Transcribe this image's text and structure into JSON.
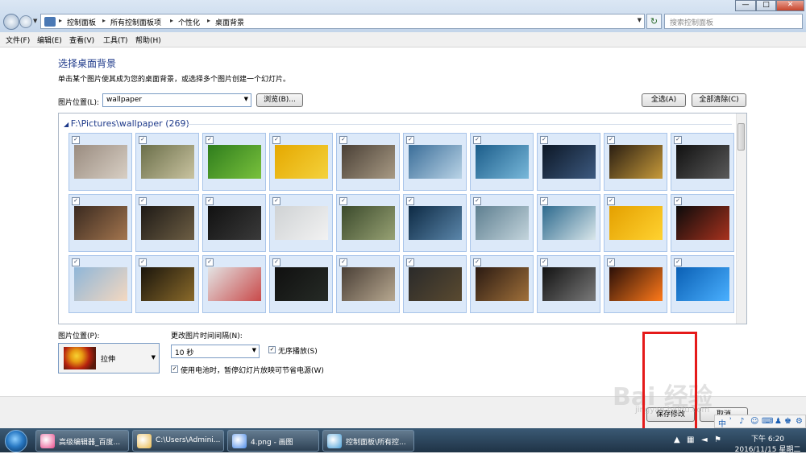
{
  "window": {
    "breadcrumbs": [
      "控制面板",
      "所有控制面板项",
      "个性化",
      "桌面背景"
    ],
    "search_placeholder": "搜索控制面板",
    "buttons": {
      "minimize": "—",
      "maximize": "□",
      "close": "✕"
    }
  },
  "menu": [
    {
      "label": "文件(F)"
    },
    {
      "label": "编辑(E)"
    },
    {
      "label": "查看(V)"
    },
    {
      "label": "工具(T)"
    },
    {
      "label": "帮助(H)"
    }
  ],
  "page": {
    "heading": "选择桌面背景",
    "subtext": "单击某个图片使其成为您的桌面背景，或选择多个图片创建一个幻灯片。",
    "location_label": "图片位置(L):",
    "location_value": "wallpaper",
    "browse_label": "浏览(B)...",
    "select_all_label": "全选(A)",
    "clear_all_label": "全部清除(C)"
  },
  "gallery": {
    "group_title": "F:\\Pictures\\wallpaper (269)",
    "checkmark": "✓",
    "rows": [
      [
        {
          "colors": [
            "#9a8c80",
            "#d8cfc4"
          ]
        },
        {
          "colors": [
            "#6b6f4a",
            "#c9c3a0"
          ]
        },
        {
          "colors": [
            "#2f7d1d",
            "#79c13c"
          ]
        },
        {
          "colors": [
            "#e5a800",
            "#f4d23c"
          ]
        },
        {
          "colors": [
            "#4a4036",
            "#a89a84"
          ]
        },
        {
          "colors": [
            "#3b6e99",
            "#b9d3e6"
          ]
        },
        {
          "colors": [
            "#1c5d8a",
            "#78b8da"
          ]
        },
        {
          "colors": [
            "#0c1726",
            "#3d5a80"
          ]
        },
        {
          "colors": [
            "#2a1e12",
            "#c79a3a"
          ]
        },
        {
          "colors": [
            "#111111",
            "#5a5a5a"
          ]
        }
      ],
      [
        {
          "colors": [
            "#3a2a20",
            "#a3754e"
          ]
        },
        {
          "colors": [
            "#1e1a16",
            "#6d5e44"
          ]
        },
        {
          "colors": [
            "#111111",
            "#3a3a3a"
          ]
        },
        {
          "colors": [
            "#cfd2d4",
            "#f2f2f2"
          ]
        },
        {
          "colors": [
            "#3b4a2c",
            "#97a173"
          ]
        },
        {
          "colors": [
            "#0d2a44",
            "#5b86aa"
          ]
        },
        {
          "colors": [
            "#5e7f90",
            "#c3d4dc"
          ]
        },
        {
          "colors": [
            "#2d6a8e",
            "#d9e6ea"
          ]
        },
        {
          "colors": [
            "#e4a000",
            "#ffd230"
          ]
        },
        {
          "colors": [
            "#0b0b0b",
            "#a8321e"
          ]
        },
        {
          "colors": [
            "#7a8a94",
            "#e6ecf0"
          ]
        }
      ],
      [
        {
          "colors": [
            "#8fb6d8",
            "#f4d8c0"
          ]
        },
        {
          "colors": [
            "#1a150c",
            "#8a6a2a"
          ]
        },
        {
          "colors": [
            "#e3e3e3",
            "#c94a4a"
          ]
        },
        {
          "colors": [
            "#101010",
            "#262b26"
          ]
        },
        {
          "colors": [
            "#4a3f36",
            "#b7a890"
          ]
        },
        {
          "colors": [
            "#2a2a2a",
            "#5a4a30"
          ]
        },
        {
          "colors": [
            "#2a1a12",
            "#a0703a"
          ]
        },
        {
          "colors": [
            "#121212",
            "#7a7a7a"
          ]
        },
        {
          "colors": [
            "#2a0f08",
            "#ff7a1a"
          ]
        },
        {
          "colors": [
            "#0a5fb4",
            "#4ab0ff"
          ]
        }
      ]
    ]
  },
  "bottom": {
    "position_label": "图片位置(P):",
    "position_value": "拉伸",
    "interval_label": "更改图片时间间隔(N):",
    "interval_value": "10 秒",
    "shuffle_label": "无序播放(S)",
    "battery_label": "使用电池时，暂停幻灯片放映可节省电源(W)",
    "save_label": "保存修改",
    "cancel_label": "取消"
  },
  "watermark": {
    "main": "Bai 经验",
    "sub": "jingyan.baidu.com"
  },
  "taskbar": {
    "items": [
      {
        "label": "高级编辑器_百度...",
        "color": "#e84a8a"
      },
      {
        "label": "C:\\Users\\Admini...",
        "color": "#e8b84a"
      },
      {
        "label": "4.png - 画图",
        "color": "#4a8ae8"
      },
      {
        "label": "控制面板\\所有控...",
        "color": "#4aa0d8"
      }
    ],
    "clock_time": "下午 6:20",
    "clock_date": "2016/11/15 星期二"
  }
}
